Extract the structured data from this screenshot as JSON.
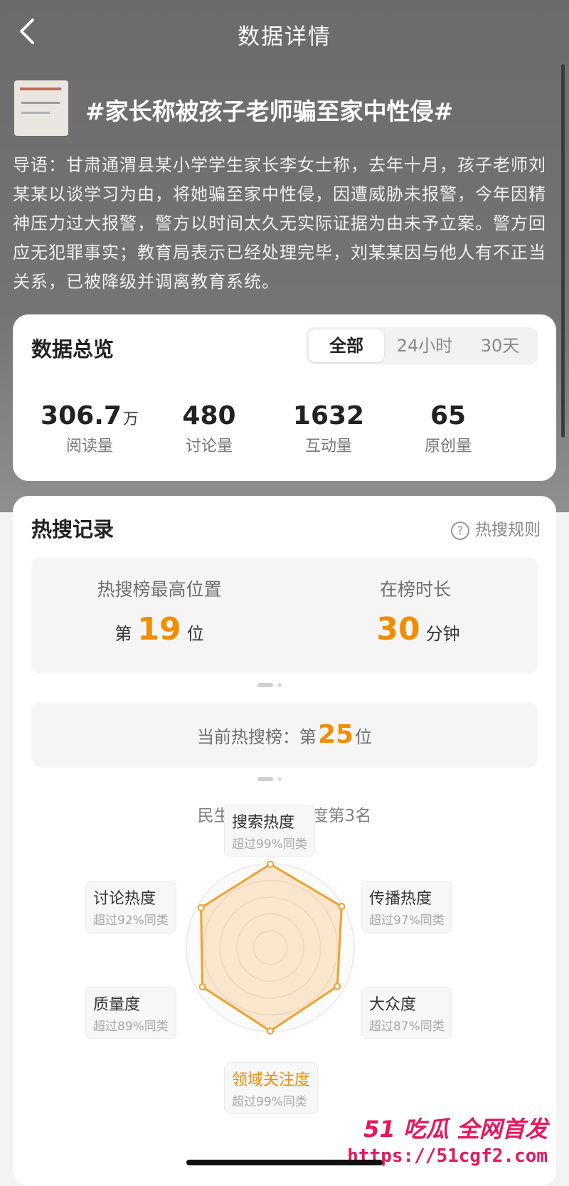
{
  "header": {
    "title": "数据详情",
    "back_icon": "chevron-left-icon"
  },
  "topic": {
    "title": "#家长称被孩子老师骗至家中性侵#",
    "intro": "导语：甘肃通渭县某小学学生家长李女士称，去年十月，孩子老师刘某某以谈学习为由，将她骗至家中性侵，因遭威胁未报警，今年因精神压力过大报警，警方以时间太久无实际证据为由未予立案。警方回应无犯罪事实；教育局表示已经处理完毕，刘某某因与他人有不正当关系，已被降级并调离教育系统。"
  },
  "overview": {
    "title": "数据总览",
    "tabs": [
      "全部",
      "24小时",
      "30天"
    ],
    "active_tab": "全部",
    "stats": [
      {
        "value": "306.7",
        "unit": "万",
        "label": "阅读量"
      },
      {
        "value": "480",
        "unit": "",
        "label": "讨论量"
      },
      {
        "value": "1632",
        "unit": "",
        "label": "互动量"
      },
      {
        "value": "65",
        "unit": "",
        "label": "原创量"
      }
    ]
  },
  "hot_search": {
    "title": "热搜记录",
    "rules_label": "热搜规则",
    "peak_label": "热搜榜最高位置",
    "peak_prefix": "第",
    "peak_value": "19",
    "peak_suffix": "位",
    "duration_label": "在榜时长",
    "duration_value": "30",
    "duration_unit": "分钟",
    "current_prefix": "当前热搜榜：第",
    "current_value": "25",
    "current_suffix": "位",
    "field_rank": "民生新闻领域热度第3名",
    "accent_color": "#f28d00"
  },
  "radar": {
    "axes": [
      {
        "name": "搜索热度",
        "sub": "超过99%同类",
        "percentile": 99
      },
      {
        "name": "传播热度",
        "sub": "超过97%同类",
        "percentile": 97
      },
      {
        "name": "大众度",
        "sub": "超过87%同类",
        "percentile": 87
      },
      {
        "name": "领域关注度",
        "sub": "超过99%同类",
        "percentile": 99
      },
      {
        "name": "质量度",
        "sub": "超过89%同类",
        "percentile": 89
      },
      {
        "name": "讨论热度",
        "sub": "超过92%同类",
        "percentile": 92
      }
    ]
  },
  "watermark": {
    "brand_num": "51",
    "brand_text": "吃瓜 全网首发",
    "url": "https://51cgf2.com"
  }
}
